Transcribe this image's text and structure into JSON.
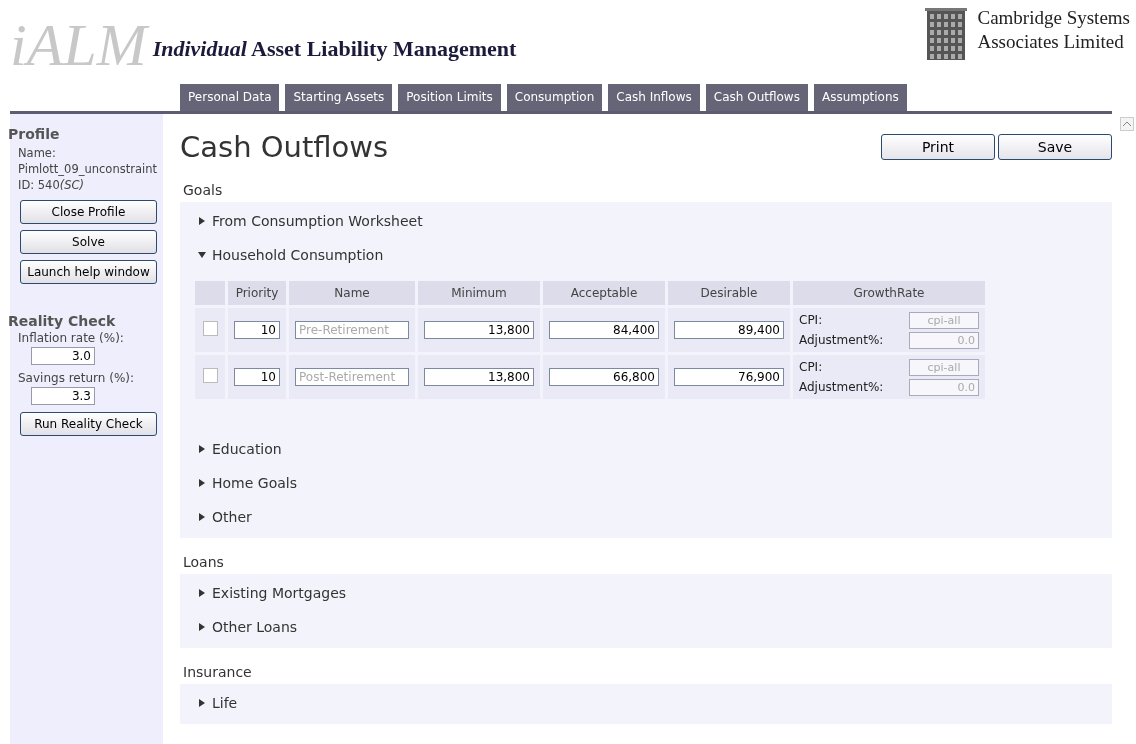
{
  "header": {
    "logo": "iALM",
    "title_italic": "Individual",
    "title": "Asset Liability Management",
    "company_line1": "Cambridge Systems",
    "company_line2": "Associates Limited"
  },
  "tabs": [
    {
      "label": "Personal Data"
    },
    {
      "label": "Starting Assets"
    },
    {
      "label": "Position Limits"
    },
    {
      "label": "Consumption"
    },
    {
      "label": "Cash Inflows"
    },
    {
      "label": "Cash Outflows"
    },
    {
      "label": "Assumptions"
    }
  ],
  "sidebar": {
    "profile_heading": "Profile",
    "name_label": "Name:",
    "name": "Pimlott_09_unconstraint",
    "id_label": "ID: 540",
    "id_tag": "(SC)",
    "buttons": [
      "Close Profile",
      "Solve",
      "Launch help window"
    ],
    "reality_heading": "Reality Check",
    "fields": [
      {
        "label": "Inflation rate (%):",
        "value": "3.0"
      },
      {
        "label": "Savings return (%):",
        "value": "3.3"
      }
    ],
    "run_button": "Run Reality Check"
  },
  "page_title": "Cash Outflows",
  "actions": [
    "Print",
    "Save"
  ],
  "sections": [
    {
      "heading": "Goals",
      "items": [
        {
          "label": "From Consumption Worksheet",
          "expanded": false
        },
        {
          "label": "Household Consumption",
          "expanded": true,
          "table": {
            "columns": [
              "Priority",
              "Name",
              "Minimum",
              "Acceptable",
              "Desirable",
              "GrowthRate"
            ],
            "rows": [
              {
                "checked": false,
                "priority": "10",
                "name_placeholder": "Pre-Retirement",
                "minimum": "13,800",
                "acceptable": "84,400",
                "desirable": "89,400",
                "cpi_label": "CPI:",
                "cpi": "cpi-all",
                "adj_label": "Adjustment%:",
                "adj": "0.0",
                "growth_disabled": true
              },
              {
                "checked": false,
                "priority": "10",
                "name_placeholder": "Post-Retirement",
                "minimum": "13,800",
                "acceptable": "66,800",
                "desirable": "76,900",
                "cpi_label": "CPI:",
                "cpi": "cpi-all",
                "adj_label": "Adjustment%:",
                "adj": "0.0",
                "growth_disabled": true
              }
            ]
          }
        },
        {
          "label": "Education",
          "expanded": false
        },
        {
          "label": "Home Goals",
          "expanded": false
        },
        {
          "label": "Other",
          "expanded": false
        }
      ]
    },
    {
      "heading": "Loans",
      "items": [
        {
          "label": "Existing Mortgages",
          "expanded": false
        },
        {
          "label": "Other Loans",
          "expanded": false
        }
      ]
    },
    {
      "heading": "Insurance",
      "items": [
        {
          "label": "Life",
          "expanded": false
        }
      ]
    }
  ]
}
